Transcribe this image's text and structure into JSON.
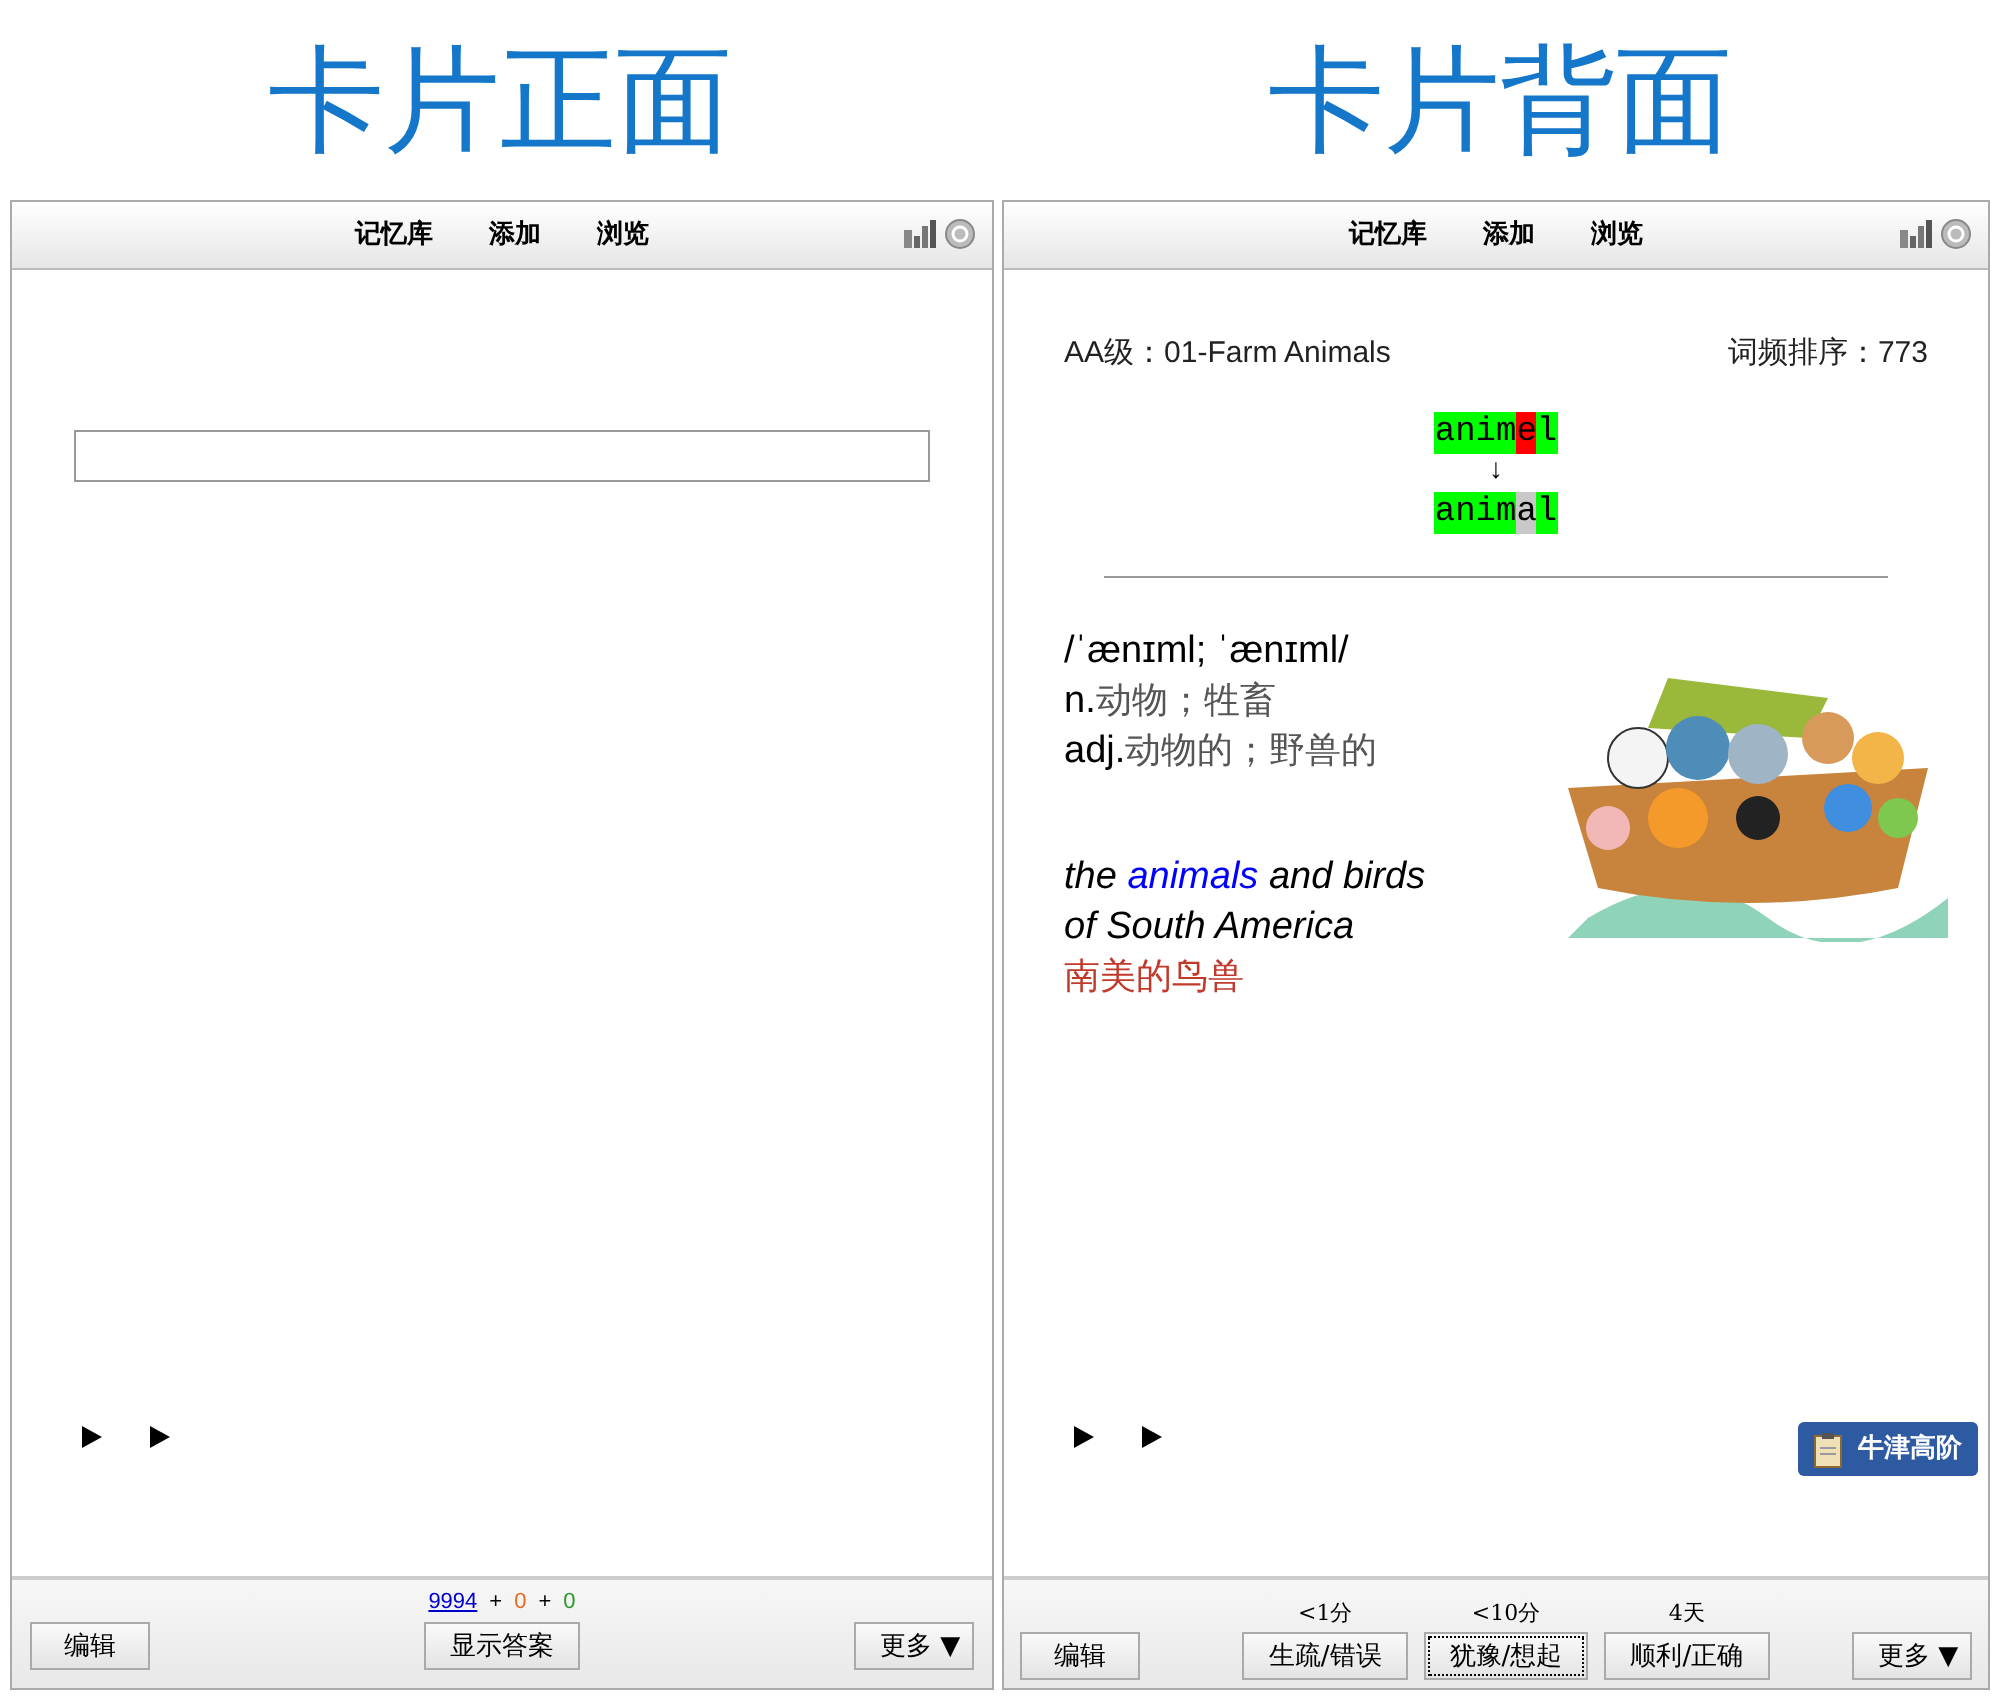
{
  "captions": [
    "卡片正面",
    "卡片背面"
  ],
  "front": {
    "nav": [
      "记忆库",
      "添加",
      "浏览"
    ],
    "counts": [
      {
        "text": "9994",
        "kind": "link"
      },
      {
        "text": "+",
        "kind": "plain"
      },
      {
        "text": "0",
        "kind": "learn"
      },
      {
        "text": "+",
        "kind": "plain"
      },
      {
        "text": "0",
        "kind": "review"
      }
    ],
    "edit_button": "编辑",
    "show_answer_button": "显示答案",
    "more_button": "更多 ▼"
  },
  "back": {
    "nav": [
      "记忆库",
      "添加",
      "浏览"
    ],
    "deck": "AA级：01-Farm Animals",
    "frequency": "词频排序：773",
    "typed": [
      {
        "text": "anim",
        "color": "#00ff00"
      },
      {
        "text": "e",
        "color": "#ff0000"
      },
      {
        "text": "l",
        "color": "#00ff00"
      }
    ],
    "arrow": "↓",
    "expected": [
      {
        "text": "anim",
        "color": "#00ff00"
      },
      {
        "text": "a",
        "color": "#c8c8c8"
      },
      {
        "text": "l",
        "color": "#00ff00"
      }
    ],
    "phonetic": "/ˈænɪml; ˈænɪml/",
    "definitions": [
      {
        "pos": "n.",
        "meaning": "动物；牲畜"
      },
      {
        "pos": "adj.",
        "meaning": "动物的；野兽的"
      }
    ],
    "example": {
      "before": "the ",
      "highlight": "animals",
      "after": " and birds of South America"
    },
    "translation": "南美的鸟兽",
    "dictionary_button": "牛津高阶",
    "edit_button": "编辑",
    "answers": [
      {
        "interval": "<1分",
        "label": "生疏/错误",
        "focused": false
      },
      {
        "interval": "<10分",
        "label": "犹豫/想起",
        "focused": true
      },
      {
        "interval": "4天",
        "label": "顺利/正确",
        "focused": false
      }
    ],
    "more_button": "更多 ▼"
  }
}
